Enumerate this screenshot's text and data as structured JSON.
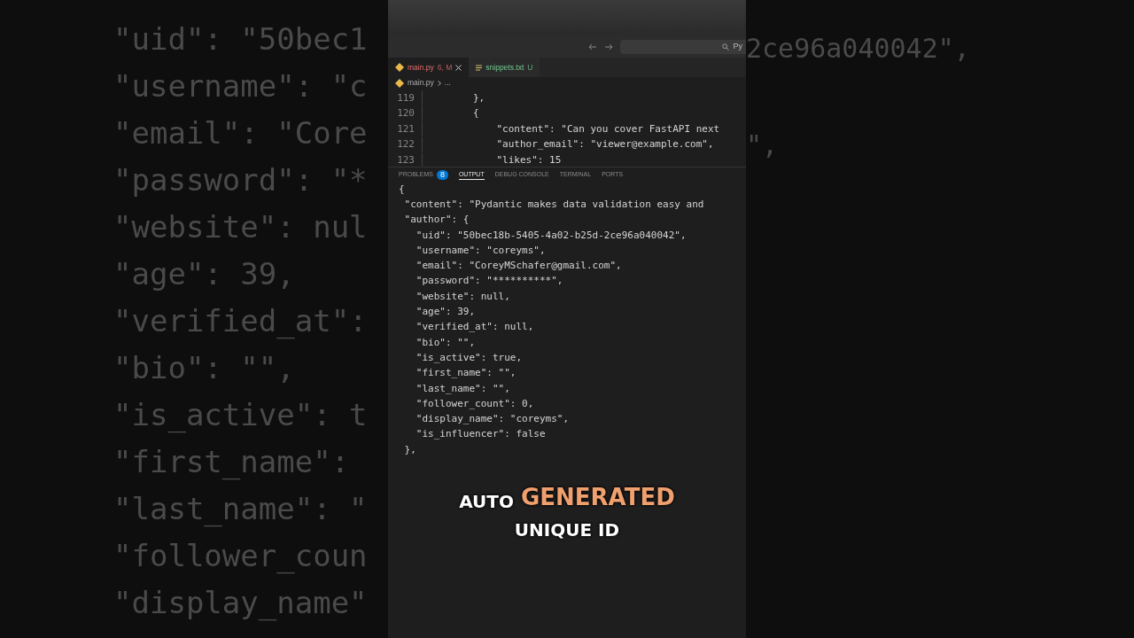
{
  "background_left": {
    "lines": [
      "\"uid\": \"50bec1",
      "\"username\": \"c",
      "\"email\": \"Core",
      "\"password\": \"*",
      "\"website\": nul",
      "\"age\": 39,",
      "\"verified_at\":",
      "\"bio\": \"\",",
      "\"is_active\": t",
      "\"first_name\":",
      "\"last_name\": \"",
      "\"follower_coun",
      "\"display_name\""
    ]
  },
  "background_right": {
    "lines": [
      "2ce96a040042\",",
      "\","
    ]
  },
  "search": {
    "value": "Py"
  },
  "tabs": [
    {
      "label": "main.py",
      "badge": "6, M",
      "selected": true,
      "kind": "python"
    },
    {
      "label": "snippets.txt",
      "badge": "U",
      "selected": false,
      "kind": "text"
    }
  ],
  "breadcrumb": {
    "file": "main.py",
    "rest": "..."
  },
  "editor": {
    "lines": [
      {
        "number": "119",
        "code": "        },"
      },
      {
        "number": "120",
        "code": "        {"
      },
      {
        "number": "121",
        "code": "            \"content\": \"Can you cover FastAPI next"
      },
      {
        "number": "122",
        "code": "            \"author_email\": \"viewer@example.com\","
      },
      {
        "number": "123",
        "code": "            \"likes\": 15"
      }
    ]
  },
  "panel_tabs": [
    {
      "label": "PROBLEMS",
      "badge": "8",
      "selected": false
    },
    {
      "label": "OUTPUT",
      "selected": true
    },
    {
      "label": "DEBUG CONSOLE",
      "selected": false
    },
    {
      "label": "TERMINAL",
      "selected": false
    },
    {
      "label": "PORTS",
      "selected": false
    }
  ],
  "output": {
    "first": "{",
    "lines": [
      " \"content\": \"Pydantic makes data validation easy and",
      " \"author\": {",
      "   \"uid\": \"50bec18b-5405-4a02-b25d-2ce96a040042\",",
      "   \"username\": \"coreyms\",",
      "   \"email\": \"CoreyMSchafer@gmail.com\",",
      "   \"password\": \"**********\",",
      "   \"website\": null,",
      "   \"age\": 39,",
      "   \"verified_at\": null,",
      "   \"bio\": \"\",",
      "   \"is_active\": true,",
      "   \"first_name\": \"\",",
      "   \"last_name\": \"\",",
      "   \"follower_count\": 0,",
      "   \"display_name\": \"coreyms\",",
      "   \"is_influencer\": false",
      " },"
    ]
  },
  "caption": {
    "lines": [
      [
        {
          "text": "AUTO",
          "highlight": false
        },
        {
          "text": "GENERATED",
          "highlight": true
        }
      ],
      [
        {
          "text": "UNIQUE ID",
          "highlight": false
        }
      ]
    ]
  }
}
